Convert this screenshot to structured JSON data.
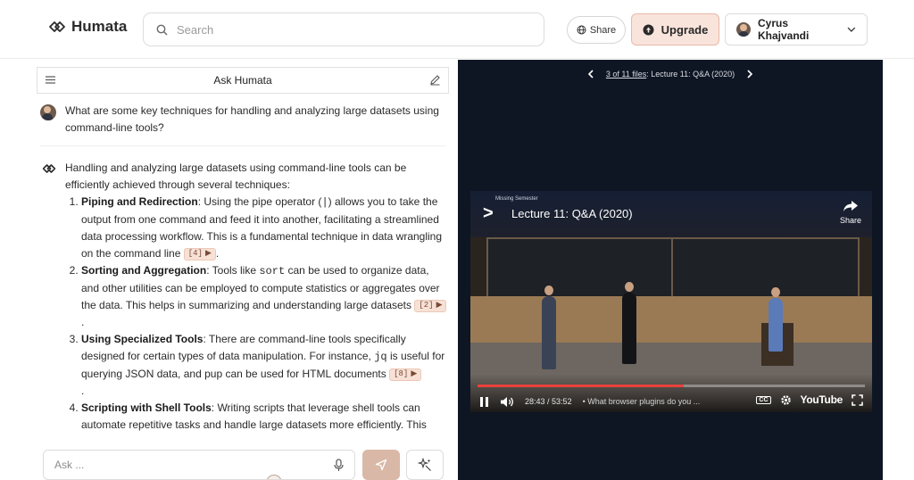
{
  "app": {
    "name": "Humata"
  },
  "search": {
    "placeholder": "Search"
  },
  "header": {
    "share_label": "Share",
    "upgrade_label": "Upgrade",
    "user_name": "Cyrus Khajvandi"
  },
  "chat": {
    "title": "Ask Humata",
    "question": "What are some key techniques for handling and analyzing large datasets using command-line tools?",
    "answer_intro": "Handling and analyzing large datasets using command-line tools can be efficiently achieved through several techniques:",
    "items": [
      {
        "heading": "Piping and Redirection",
        "text_before": ": Using the pipe operator (",
        "code": "|",
        "text_after": ") allows you to take the output from one command and feed it into another, facilitating a streamlined data processing workflow. This is a fundamental technique in data wrangling on the command line",
        "cite": "[4]"
      },
      {
        "heading": "Sorting and Aggregation",
        "text_before": ": Tools like ",
        "code": "sort",
        "text_after": " can be used to organize data, and other utilities can be employed to compute statistics or aggregates over the data. This helps in summarizing and understanding large datasets",
        "cite": "[2]"
      },
      {
        "heading": "Using Specialized Tools",
        "text_before": ": There are command-line tools specifically designed for certain types of data manipulation. For instance, ",
        "code": "jq",
        "text_middle": " is useful for querying JSON data, and ",
        "code2": "pup",
        "text_after": " can be used for HTML documents",
        "cite": "[8]"
      },
      {
        "heading": "Scripting with Shell Tools",
        "text_after": ": Writing scripts that leverage shell tools can automate repetitive tasks and handle large datasets more efficiently. This"
      }
    ],
    "input_placeholder": "Ask ..."
  },
  "viewer": {
    "file_position": "3 of 11 files",
    "file_title": ": Lecture 11: Q&A (2020)",
    "video_title": "Lecture 11: Q&A (2020)",
    "channel": "Missing Semester",
    "share_label": "Share",
    "time_current": "28:43",
    "time_total": "53:52",
    "chapter": "• What browser plugins do you ...",
    "progress": 0.533,
    "cc_label": "CC",
    "youtube_label": "YouTube"
  },
  "colors": {
    "accent": "#f9e4dc",
    "accent_border": "#e8b9a7",
    "cite_bg": "#f7e1d6",
    "viewer_bg": "#0f1623",
    "progress": "#e8423b"
  }
}
